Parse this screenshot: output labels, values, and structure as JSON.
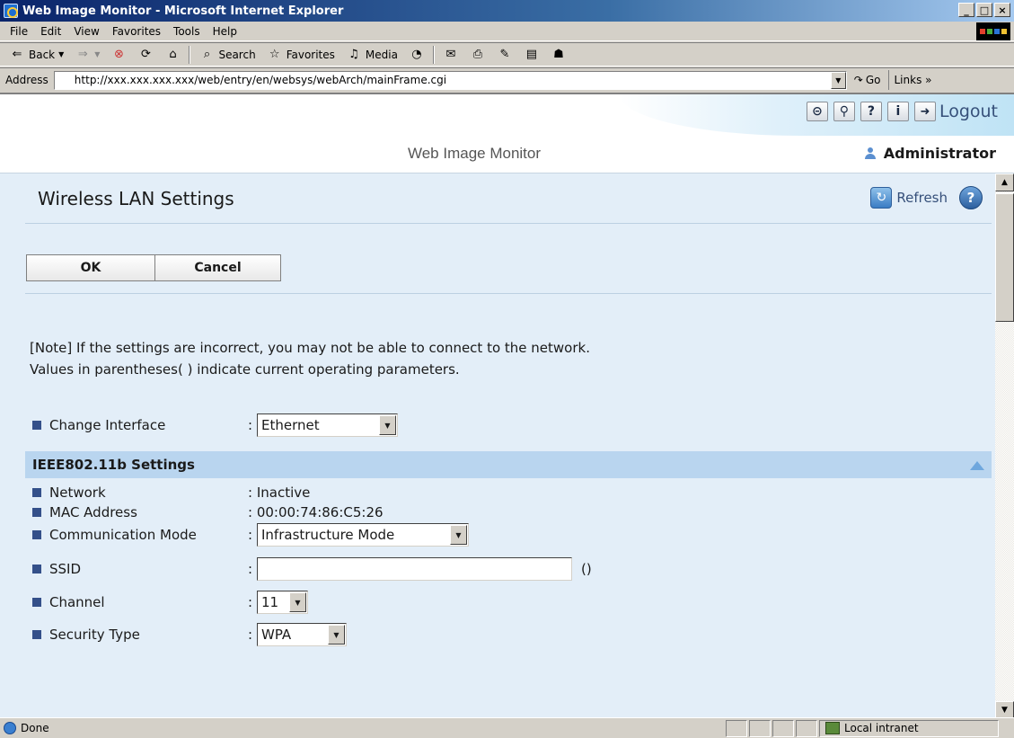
{
  "window": {
    "title": "Web Image Monitor - Microsoft Internet Explorer",
    "controls": [
      "_",
      "□",
      "×"
    ]
  },
  "menu": [
    "File",
    "Edit",
    "View",
    "Favorites",
    "Tools",
    "Help"
  ],
  "toolbar": {
    "back": "Back",
    "search": "Search",
    "favorites": "Favorites",
    "media": "Media"
  },
  "address": {
    "label": "Address",
    "url": "http://xxx.xxx.xxx.xxx/web/entry/en/websys/webArch/mainFrame.cgi",
    "go": "Go",
    "links": "Links »"
  },
  "header": {
    "logout": "Logout",
    "app_title": "Web Image Monitor",
    "user": "Administrator",
    "icons": [
      "link-icon",
      "search-icon",
      "help-icon",
      "info-icon"
    ]
  },
  "page": {
    "title": "Wireless LAN Settings",
    "refresh": "Refresh",
    "ok": "OK",
    "cancel": "Cancel",
    "note_line1": "[Note] If the settings are incorrect, you may not be able to connect to the network.",
    "note_line2": "Values in parentheses( ) indicate current operating parameters."
  },
  "form": {
    "change_interface_label": "Change Interface",
    "change_interface_value": "Ethernet",
    "section_title": "IEEE802.11b Settings",
    "network_label": "Network",
    "network_value": ": Inactive",
    "mac_label": "MAC Address",
    "mac_value": ": 00:00:74:86:C5:26",
    "comm_mode_label": "Communication Mode",
    "comm_mode_value": "Infrastructure Mode",
    "ssid_label": "SSID",
    "ssid_value": "",
    "ssid_current": "()",
    "channel_label": "Channel",
    "channel_value": "11",
    "security_label": "Security Type",
    "security_value": "WPA"
  },
  "status": {
    "text": "Done",
    "zone": "Local intranet"
  },
  "colors": {
    "section_bg": "#b9d5ef",
    "content_bg": "#e3eef8",
    "bullet": "#34508a",
    "titlebar": "#0a246a"
  }
}
